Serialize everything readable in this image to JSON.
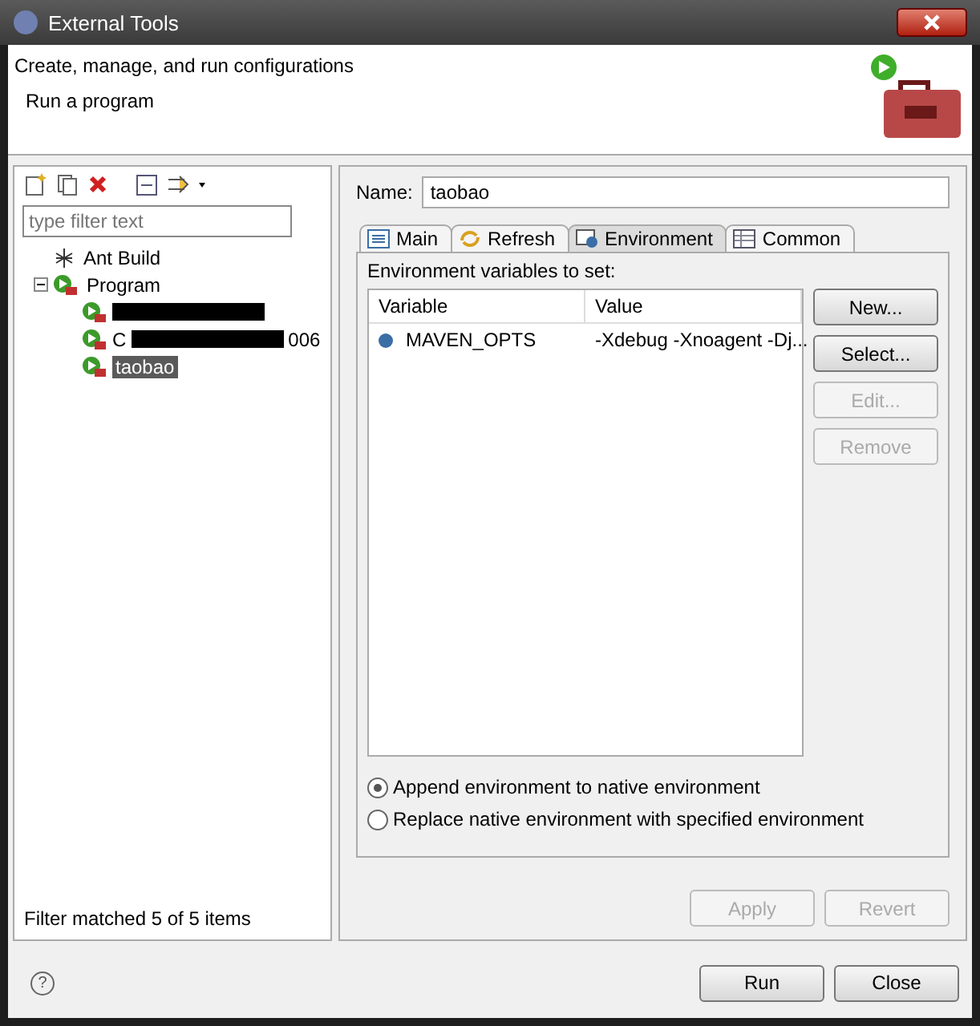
{
  "window": {
    "title": "External Tools"
  },
  "header": {
    "title": "Create, manage, and run configurations",
    "message": "Run a program"
  },
  "sidebar": {
    "filter": {
      "placeholder": "type filter text"
    },
    "tree": [
      {
        "label": "Ant Build",
        "kind": "ant",
        "selected": false
      },
      {
        "label": "Program",
        "kind": "program",
        "expanded": true,
        "selected": false,
        "children": [
          {
            "kind": "redacted"
          },
          {
            "kind": "redacted",
            "prefix": "C",
            "suffix": "006"
          },
          {
            "label": "taobao",
            "kind": "program",
            "selected": true
          }
        ]
      }
    ],
    "status": "Filter matched 5 of 5 items"
  },
  "editor": {
    "name_label": "Name:",
    "name_value": "taobao",
    "tabs": [
      {
        "label": "Main",
        "selected": false
      },
      {
        "label": "Refresh",
        "selected": false
      },
      {
        "label": "Environment",
        "selected": true
      },
      {
        "label": "Common",
        "selected": false
      }
    ],
    "section_label": "Environment variables to set:",
    "columns": [
      "Variable",
      "Value"
    ],
    "rows": [
      {
        "variable": "MAVEN_OPTS",
        "value": "-Xdebug -Xnoagent -Dj..."
      }
    ],
    "side_buttons": [
      {
        "label": "New...",
        "disabled": false
      },
      {
        "label": "Select...",
        "disabled": false
      },
      {
        "label": "Edit...",
        "disabled": true
      },
      {
        "label": "Remove",
        "disabled": true
      }
    ],
    "radios": [
      {
        "label": "Append environment to native environment",
        "selected": true
      },
      {
        "label": "Replace native environment with specified environment",
        "selected": false
      }
    ],
    "buttons": [
      {
        "label": "Apply",
        "disabled": true
      },
      {
        "label": "Revert",
        "disabled": true
      }
    ]
  },
  "footer": {
    "help": "?",
    "buttons": [
      {
        "label": "Run",
        "disabled": false
      },
      {
        "label": "Close",
        "disabled": false
      }
    ]
  }
}
